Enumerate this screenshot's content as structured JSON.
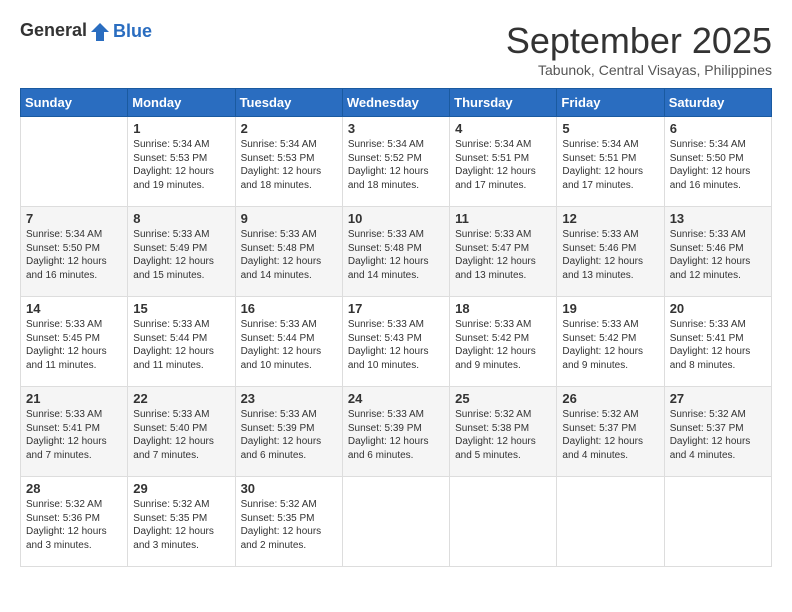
{
  "header": {
    "logo_general": "General",
    "logo_blue": "Blue",
    "month": "September 2025",
    "location": "Tabunok, Central Visayas, Philippines"
  },
  "weekdays": [
    "Sunday",
    "Monday",
    "Tuesday",
    "Wednesday",
    "Thursday",
    "Friday",
    "Saturday"
  ],
  "weeks": [
    [
      {
        "day": "",
        "info": ""
      },
      {
        "day": "1",
        "info": "Sunrise: 5:34 AM\nSunset: 5:53 PM\nDaylight: 12 hours\nand 19 minutes."
      },
      {
        "day": "2",
        "info": "Sunrise: 5:34 AM\nSunset: 5:53 PM\nDaylight: 12 hours\nand 18 minutes."
      },
      {
        "day": "3",
        "info": "Sunrise: 5:34 AM\nSunset: 5:52 PM\nDaylight: 12 hours\nand 18 minutes."
      },
      {
        "day": "4",
        "info": "Sunrise: 5:34 AM\nSunset: 5:51 PM\nDaylight: 12 hours\nand 17 minutes."
      },
      {
        "day": "5",
        "info": "Sunrise: 5:34 AM\nSunset: 5:51 PM\nDaylight: 12 hours\nand 17 minutes."
      },
      {
        "day": "6",
        "info": "Sunrise: 5:34 AM\nSunset: 5:50 PM\nDaylight: 12 hours\nand 16 minutes."
      }
    ],
    [
      {
        "day": "7",
        "info": "Sunrise: 5:34 AM\nSunset: 5:50 PM\nDaylight: 12 hours\nand 16 minutes."
      },
      {
        "day": "8",
        "info": "Sunrise: 5:33 AM\nSunset: 5:49 PM\nDaylight: 12 hours\nand 15 minutes."
      },
      {
        "day": "9",
        "info": "Sunrise: 5:33 AM\nSunset: 5:48 PM\nDaylight: 12 hours\nand 14 minutes."
      },
      {
        "day": "10",
        "info": "Sunrise: 5:33 AM\nSunset: 5:48 PM\nDaylight: 12 hours\nand 14 minutes."
      },
      {
        "day": "11",
        "info": "Sunrise: 5:33 AM\nSunset: 5:47 PM\nDaylight: 12 hours\nand 13 minutes."
      },
      {
        "day": "12",
        "info": "Sunrise: 5:33 AM\nSunset: 5:46 PM\nDaylight: 12 hours\nand 13 minutes."
      },
      {
        "day": "13",
        "info": "Sunrise: 5:33 AM\nSunset: 5:46 PM\nDaylight: 12 hours\nand 12 minutes."
      }
    ],
    [
      {
        "day": "14",
        "info": "Sunrise: 5:33 AM\nSunset: 5:45 PM\nDaylight: 12 hours\nand 11 minutes."
      },
      {
        "day": "15",
        "info": "Sunrise: 5:33 AM\nSunset: 5:44 PM\nDaylight: 12 hours\nand 11 minutes."
      },
      {
        "day": "16",
        "info": "Sunrise: 5:33 AM\nSunset: 5:44 PM\nDaylight: 12 hours\nand 10 minutes."
      },
      {
        "day": "17",
        "info": "Sunrise: 5:33 AM\nSunset: 5:43 PM\nDaylight: 12 hours\nand 10 minutes."
      },
      {
        "day": "18",
        "info": "Sunrise: 5:33 AM\nSunset: 5:42 PM\nDaylight: 12 hours\nand 9 minutes."
      },
      {
        "day": "19",
        "info": "Sunrise: 5:33 AM\nSunset: 5:42 PM\nDaylight: 12 hours\nand 9 minutes."
      },
      {
        "day": "20",
        "info": "Sunrise: 5:33 AM\nSunset: 5:41 PM\nDaylight: 12 hours\nand 8 minutes."
      }
    ],
    [
      {
        "day": "21",
        "info": "Sunrise: 5:33 AM\nSunset: 5:41 PM\nDaylight: 12 hours\nand 7 minutes."
      },
      {
        "day": "22",
        "info": "Sunrise: 5:33 AM\nSunset: 5:40 PM\nDaylight: 12 hours\nand 7 minutes."
      },
      {
        "day": "23",
        "info": "Sunrise: 5:33 AM\nSunset: 5:39 PM\nDaylight: 12 hours\nand 6 minutes."
      },
      {
        "day": "24",
        "info": "Sunrise: 5:33 AM\nSunset: 5:39 PM\nDaylight: 12 hours\nand 6 minutes."
      },
      {
        "day": "25",
        "info": "Sunrise: 5:32 AM\nSunset: 5:38 PM\nDaylight: 12 hours\nand 5 minutes."
      },
      {
        "day": "26",
        "info": "Sunrise: 5:32 AM\nSunset: 5:37 PM\nDaylight: 12 hours\nand 4 minutes."
      },
      {
        "day": "27",
        "info": "Sunrise: 5:32 AM\nSunset: 5:37 PM\nDaylight: 12 hours\nand 4 minutes."
      }
    ],
    [
      {
        "day": "28",
        "info": "Sunrise: 5:32 AM\nSunset: 5:36 PM\nDaylight: 12 hours\nand 3 minutes."
      },
      {
        "day": "29",
        "info": "Sunrise: 5:32 AM\nSunset: 5:35 PM\nDaylight: 12 hours\nand 3 minutes."
      },
      {
        "day": "30",
        "info": "Sunrise: 5:32 AM\nSunset: 5:35 PM\nDaylight: 12 hours\nand 2 minutes."
      },
      {
        "day": "",
        "info": ""
      },
      {
        "day": "",
        "info": ""
      },
      {
        "day": "",
        "info": ""
      },
      {
        "day": "",
        "info": ""
      }
    ]
  ]
}
